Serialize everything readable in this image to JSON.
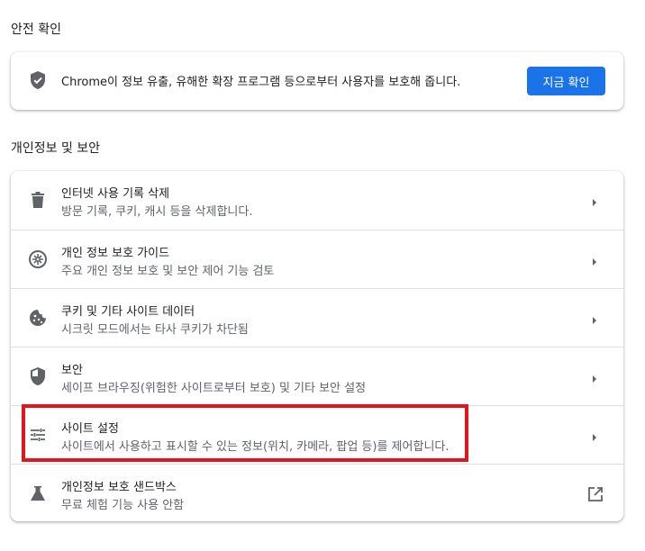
{
  "safety": {
    "title": "안전 확인",
    "description": "Chrome이 정보 유출, 유해한 확장 프로그램 등으로부터 사용자를 보호해 줍니다.",
    "button_label": "지금 확인"
  },
  "privacy": {
    "title": "개인정보 및 보안",
    "items": [
      {
        "title": "인터넷 사용 기록 삭제",
        "subtitle": "방문 기록, 쿠키, 캐시 등을 삭제합니다.",
        "icon": "trash-icon"
      },
      {
        "title": "개인 정보 보호 가이드",
        "subtitle": "주요 개인 정보 보호 및 보안 제어 기능 검토",
        "icon": "compass-icon"
      },
      {
        "title": "쿠키 및 기타 사이트 데이터",
        "subtitle": "시크릿 모드에서는 타사 쿠키가 차단됨",
        "icon": "cookie-icon"
      },
      {
        "title": "보안",
        "subtitle": "세이프 브라우징(위험한 사이트로부터 보호) 및 기타 보안 설정",
        "icon": "shield-icon"
      },
      {
        "title": "사이트 설정",
        "subtitle": "사이트에서 사용하고 표시할 수 있는 정보(위치, 카메라, 팝업 등)를 제어합니다.",
        "icon": "tune-icon"
      },
      {
        "title": "개인정보 보호 샌드박스",
        "subtitle": "무료 체험 기능 사용 안함",
        "icon": "flask-icon"
      }
    ]
  },
  "colors": {
    "accent": "#1a73e8",
    "highlight": "#e3141e",
    "icon": "#5f6368"
  }
}
